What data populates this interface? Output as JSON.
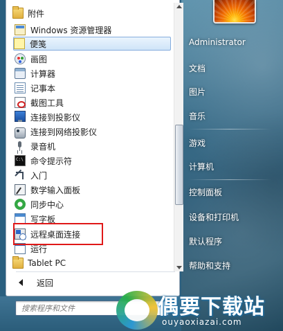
{
  "left_menu": {
    "items": [
      {
        "label": "附件",
        "icon": "folder-icon"
      },
      {
        "label": "Windows 资源管理器",
        "icon": "explorer-icon"
      },
      {
        "label": "便笺",
        "icon": "sticky-notes-icon"
      },
      {
        "label": "画图",
        "icon": "paint-icon"
      },
      {
        "label": "计算器",
        "icon": "calculator-icon"
      },
      {
        "label": "记事本",
        "icon": "notepad-icon"
      },
      {
        "label": "截图工具",
        "icon": "snipping-tool-icon"
      },
      {
        "label": "连接到投影仪",
        "icon": "projector-monitor-icon"
      },
      {
        "label": "连接到网络投影仪",
        "icon": "network-projector-icon"
      },
      {
        "label": "录音机",
        "icon": "microphone-icon"
      },
      {
        "label": "命令提示符",
        "icon": "command-prompt-icon"
      },
      {
        "label": "入门",
        "icon": "getting-started-icon"
      },
      {
        "label": "数学输入面板",
        "icon": "math-input-icon"
      },
      {
        "label": "同步中心",
        "icon": "sync-center-icon"
      },
      {
        "label": "写字板",
        "icon": "wordpad-icon"
      },
      {
        "label": "远程桌面连接",
        "icon": "remote-desktop-icon"
      },
      {
        "label": "运行",
        "icon": "run-icon"
      },
      {
        "label": "Tablet PC",
        "icon": "folder-icon"
      }
    ],
    "back_label": "返回",
    "highlight_index": 2,
    "boxed_index": 15
  },
  "search": {
    "placeholder": "搜索程序和文件"
  },
  "right_menu": {
    "items": [
      "Administrator",
      "文档",
      "图片",
      "音乐",
      "游戏",
      "计算机",
      "控制面板",
      "设备和打印机",
      "默认程序",
      "帮助和支持"
    ]
  },
  "watermark": {
    "name": "偶要下载站",
    "url": "ouyaoxiazai.com"
  },
  "colors": {
    "highlight_border": "#84acdd",
    "annotation_box": "#e01818"
  }
}
